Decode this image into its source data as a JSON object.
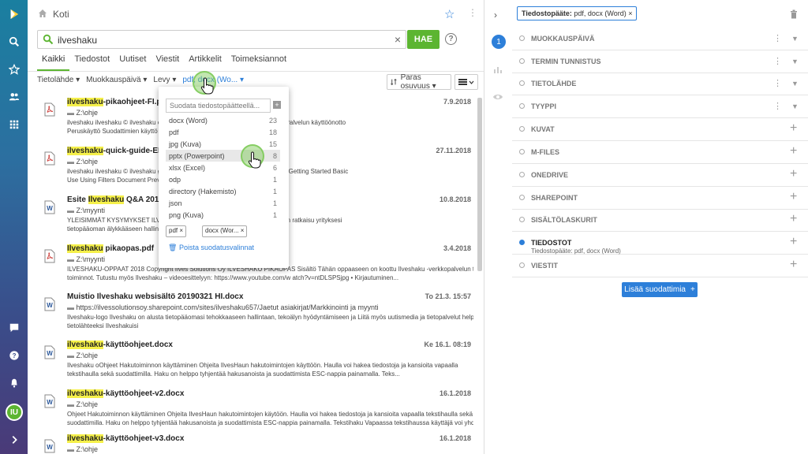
{
  "header": {
    "title": "Koti"
  },
  "search": {
    "value": "ilveshaku",
    "button": "HAE",
    "clear": "×",
    "help": "?"
  },
  "tabs": [
    "Kaikki",
    "Tiedostot",
    "Uutiset",
    "Viestit",
    "Artikkelit",
    "Toimeksiannot"
  ],
  "filters": {
    "items": [
      "Tietolähde ▾",
      "Muokkauspäivä ▾",
      "Levy ▾",
      "pdf, docx (Wo... ▾"
    ],
    "sort": "Paras osuvuus ▾"
  },
  "results": [
    {
      "pre": "",
      "hl": "ilveshaku",
      "post": "-pikaohjeet-FI.pdf",
      "date": "7.9.2018",
      "path": "Z:\\ohje",
      "icon": "pdf",
      "snip1": "ilveshaku ilveshaku © ilveshaku ohjeet … sisällys 03 04 05 06 07 08 09 10 11 Palvelun käyttöönotto",
      "snip2": "Peruskäyttö Suodattimien käyttö Dokumentin esikatselu … omalle koneell..."
    },
    {
      "pre": "",
      "hl": "ilveshaku",
      "post": "-quick-guide-EN.pdf",
      "date": "27.11.2018",
      "path": "Z:\\ohje",
      "icon": "pdf",
      "snip1": "ilveshaku ilveshaku © ilveshaku guides … Content 03 04 05 06 07 08 09 10 11 Getting Started Basic",
      "snip2": "Use Using Filters Document Preview Sh… ster Sharing Document..."
    },
    {
      "pre": "Esite ",
      "hl": "Ilveshaku",
      "post": " Q&A 20180810...",
      "date": "10.8.2018",
      "path": "Z:\\myynti",
      "icon": "word",
      "snip1": "YLEISIMMÄT KYSYMYKSET ILVESHAUSTA … Enterprise on helppokäyttöinen ratkaisu yrityksesi",
      "snip2": "tietopääoman älykkääseen hallintaan … työtehtävissä tarvittavan..."
    },
    {
      "pre": "",
      "hl": "Ilveshaku",
      "post": " pikaopas.pdf",
      "date": "3.4.2018",
      "path": "Z:\\myynti",
      "icon": "pdf",
      "snip1": "ILVESHAKU-OPPAAT 2018 Copyright Ilves Solutions Oy ILVESHAKU PIKAOPAS Sisältö Tähän oppaaseen on koottu Ilveshaku -verkkopalvelun tärkeimmät",
      "snip2": "toiminnot. Tutustu myös Ilveshaku – videoesittelyyn: https://www.youtube.com/w atch?v=ntDLSPSjpg • Kirjautuminen..."
    },
    {
      "pre": "Muistio Ilveshaku websisältö 20190321 HI.docx",
      "hl": "",
      "post": "",
      "date": "To 21.3. 15:57",
      "path": "https://ilvessolutionsoy.sharepoint.com/sites/ilveshaku657/Jaetut asiakirjat/Markkinointi ja myynti",
      "icon": "word",
      "snip1": "Ilveshaku-logo Ilveshaku on alusta tietopääomasi tehokkaaseen hallintaan, tekoälyn hyödyntämiseen ja Liitä myös uutismedia ja tietopalvelut helposti",
      "snip2": "tietolähteeksi Ilveshakuisi"
    },
    {
      "pre": "",
      "hl": "ilveshaku",
      "post": "-käyttöohjeet.docx",
      "date": "Ke 16.1. 08:19",
      "path": "Z:\\ohje",
      "icon": "word",
      "snip1": "Ilveshaku oOhjeet Hakutoiminnon käyttäminen Ohjeita IlvesHaun hakutoimintojen käyttöön. Haulla voi hakea tiedostoja ja kansioita vapaalla",
      "snip2": "tekstihaulla sekä suodattimilla. Haku on helppo tyhjentää hakusanoista ja suodattimista ESC-nappia painamalla. Teks..."
    },
    {
      "pre": "",
      "hl": "ilveshaku",
      "post": "-käyttöohjeet-v2.docx",
      "date": "16.1.2018",
      "path": "Z:\\ohje",
      "icon": "word",
      "snip1": "Ohjeet Hakutoiminnon käyttäminen Ohjeita IlvesHaun hakutoimintojen käytöön. Haulla voi hakea tiedostoja ja kansioita vapaalla tekstihaulla sekä",
      "snip2": "suodattimilla. Haku on helppo tyhjentää hakusanoista ja suodattimista ESC-nappia painamalla. Tekstihaku Vapaassa tekstihaussa käyttäjä voi yhdellä..."
    },
    {
      "pre": "",
      "hl": "ilveshaku",
      "post": "-käyttöohjeet-v3.docx",
      "date": "16.1.2018",
      "path": "Z:\\ohje",
      "icon": "word",
      "snip1": "",
      "snip2": ""
    }
  ],
  "dropdown": {
    "placeholder": "Suodata tiedostopäätteellä...",
    "options": [
      {
        "label": "docx (Word)",
        "count": "23"
      },
      {
        "label": "pdf",
        "count": "18"
      },
      {
        "label": "jpg (Kuva)",
        "count": "15"
      },
      {
        "label": "pptx (Powerpoint)",
        "count": "8"
      },
      {
        "label": "xlsx (Excel)",
        "count": "6"
      },
      {
        "label": "odp",
        "count": "1"
      },
      {
        "label": "directory (Hakemisto)",
        "count": "1"
      },
      {
        "label": "json",
        "count": "1"
      },
      {
        "label": "png (Kuva)",
        "count": "1"
      }
    ],
    "chips": [
      "pdf ×",
      "docx (Wor... ×"
    ],
    "clear": "Poista suodatusvalinnat"
  },
  "rpanel": {
    "chip_label": "Tiedostopääte:",
    "chip_value": " pdf, docx (Word) ×",
    "step": "1",
    "filters": [
      {
        "label": "MUOKKAUSPÄIVÄ",
        "kind": "kebab"
      },
      {
        "label": "TERMIN TUNNISTUS",
        "kind": "kebab"
      },
      {
        "label": "TIETOLÄHDE",
        "kind": "kebab"
      },
      {
        "label": "TYYPPI",
        "kind": "kebab"
      },
      {
        "label": "KUVAT",
        "kind": "plus"
      },
      {
        "label": "M-FILES",
        "kind": "plus"
      },
      {
        "label": "ONEDRIVE",
        "kind": "plus"
      },
      {
        "label": "SHAREPOINT",
        "kind": "plus"
      },
      {
        "label": "SISÄLTÖLASKURIT",
        "kind": "plus"
      },
      {
        "label": "TIEDOSTOT",
        "kind": "plus",
        "active": true,
        "sub": "Tiedostopääte: pdf, docx (Word)"
      },
      {
        "label": "VIESTIT",
        "kind": "plus"
      }
    ],
    "add_button": "Lisää suodattimia"
  },
  "user": {
    "initials": "IU"
  },
  "colors": {
    "accent": "#2d7fd9",
    "green": "#5cb531",
    "highlight": "#f5f04a"
  }
}
